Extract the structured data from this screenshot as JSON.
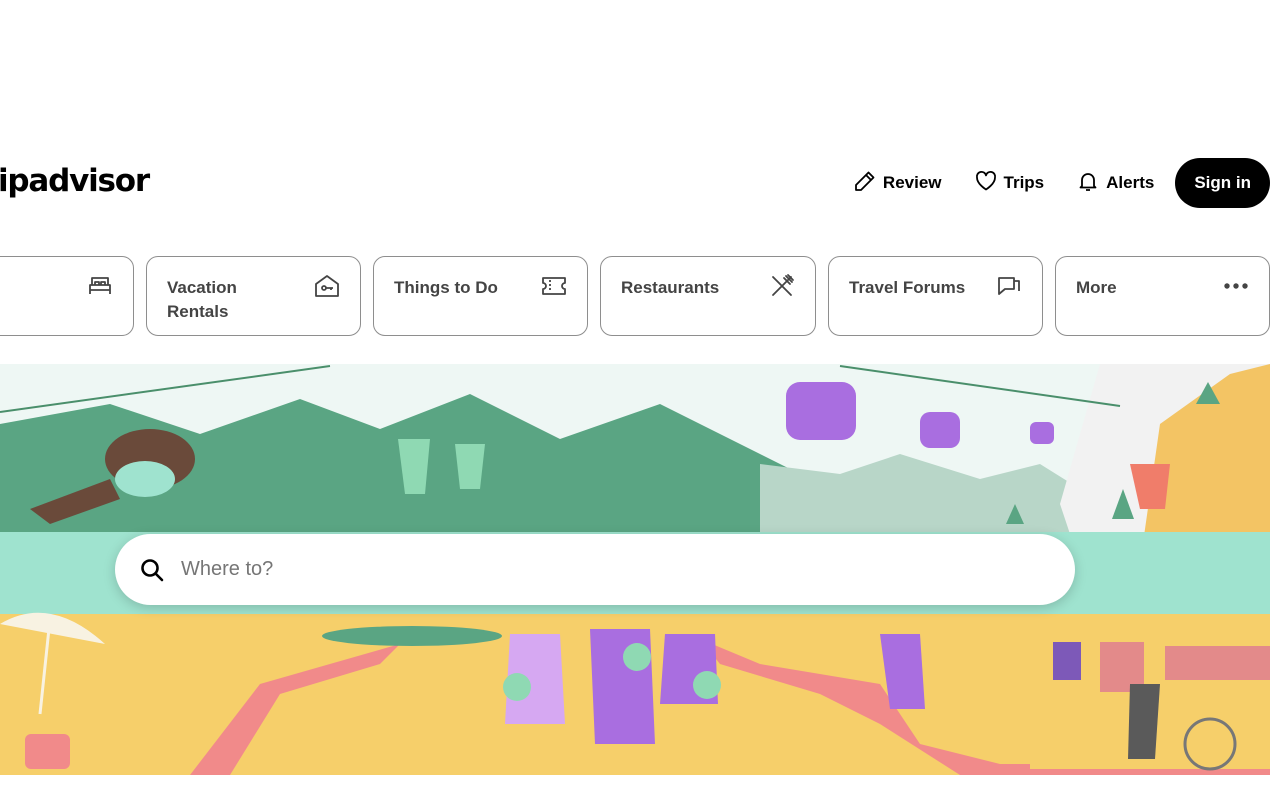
{
  "header": {
    "logo_text": "ipadvisor",
    "nav": [
      {
        "label": "Review",
        "icon": "pencil-icon"
      },
      {
        "label": "Trips",
        "icon": "heart-icon"
      },
      {
        "label": "Alerts",
        "icon": "bell-icon"
      }
    ],
    "sign_in_label": "Sign in"
  },
  "categories": [
    {
      "label": "",
      "icon": "bed-icon"
    },
    {
      "label": "Vacation Rentals",
      "icon": "house-key-icon"
    },
    {
      "label": "Things to Do",
      "icon": "ticket-icon"
    },
    {
      "label": "Restaurants",
      "icon": "fork-knife-icon"
    },
    {
      "label": "Travel Forums",
      "icon": "chat-bubble-icon"
    },
    {
      "label": "More",
      "icon": "ellipsis-icon"
    }
  ],
  "search": {
    "placeholder": "Where to?",
    "value": "",
    "icon": "search-icon"
  },
  "colors": {
    "sign_in_bg": "#000000",
    "card_border": "#8e8e8e"
  }
}
